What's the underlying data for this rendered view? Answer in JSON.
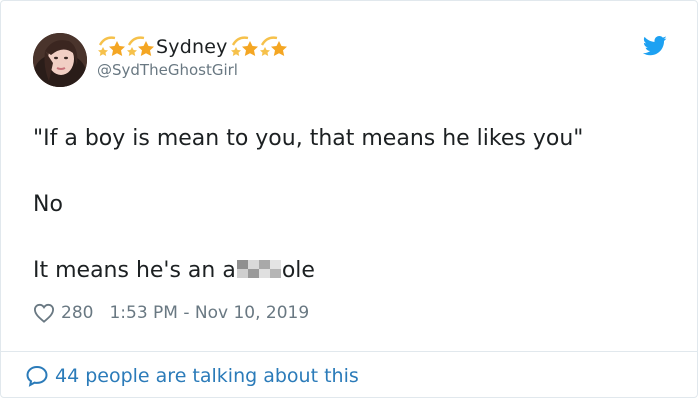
{
  "user": {
    "display_name": "Sydney",
    "handle": "@SydTheGhostGirl",
    "name_emoji": "dizzy-star-emoji"
  },
  "tweet": {
    "line1": "\"If a boy is mean to you, that means he likes you\"",
    "line2": "No",
    "line3_before": "It means he's an a",
    "line3_after": "ole"
  },
  "stats": {
    "likes": "280",
    "timestamp": "1:53 PM - Nov 10, 2019"
  },
  "footer": {
    "talking": "44 people are talking about this"
  },
  "colors": {
    "text": "#1c2022",
    "secondary": "#697882",
    "link": "#2b7bb9",
    "twitter_blue": "#1da1f2",
    "border": "#e1e8ed"
  },
  "icons": [
    "twitter-bird-icon",
    "heart-icon",
    "chat-bubble-icon"
  ]
}
